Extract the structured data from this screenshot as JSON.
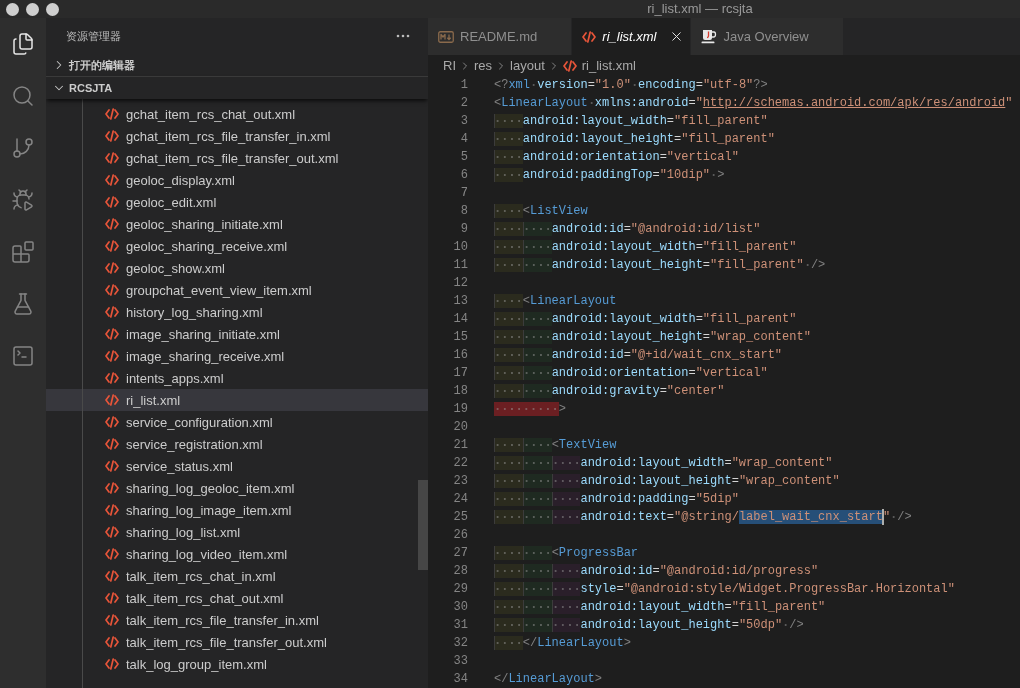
{
  "window": {
    "title": "ri_list.xml — rcsjta"
  },
  "activity_bar": [
    {
      "kind": "files",
      "selected": true
    },
    {
      "kind": "search",
      "selected": false
    },
    {
      "kind": "source_control",
      "selected": false
    },
    {
      "kind": "run_debug",
      "selected": false
    },
    {
      "kind": "extensions",
      "selected": false
    },
    {
      "kind": "testing",
      "selected": false
    },
    {
      "kind": "terminal",
      "selected": false
    }
  ],
  "sidebar": {
    "title": "资源管理器",
    "sections": [
      {
        "label": "打开的编辑器",
        "expanded": false
      },
      {
        "label": "RCSJTA",
        "expanded": true,
        "files": [
          {
            "name": "gchat_item_rcs_chat_out.xml",
            "selected": false
          },
          {
            "name": "gchat_item_rcs_file_transfer_in.xml",
            "selected": false
          },
          {
            "name": "gchat_item_rcs_file_transfer_out.xml",
            "selected": false
          },
          {
            "name": "geoloc_display.xml",
            "selected": false
          },
          {
            "name": "geoloc_edit.xml",
            "selected": false
          },
          {
            "name": "geoloc_sharing_initiate.xml",
            "selected": false
          },
          {
            "name": "geoloc_sharing_receive.xml",
            "selected": false
          },
          {
            "name": "geoloc_show.xml",
            "selected": false
          },
          {
            "name": "groupchat_event_view_item.xml",
            "selected": false
          },
          {
            "name": "history_log_sharing.xml",
            "selected": false
          },
          {
            "name": "image_sharing_initiate.xml",
            "selected": false
          },
          {
            "name": "image_sharing_receive.xml",
            "selected": false
          },
          {
            "name": "intents_apps.xml",
            "selected": false
          },
          {
            "name": "ri_list.xml",
            "selected": true
          },
          {
            "name": "service_configuration.xml",
            "selected": false
          },
          {
            "name": "service_registration.xml",
            "selected": false
          },
          {
            "name": "service_status.xml",
            "selected": false
          },
          {
            "name": "sharing_log_geoloc_item.xml",
            "selected": false
          },
          {
            "name": "sharing_log_image_item.xml",
            "selected": false
          },
          {
            "name": "sharing_log_list.xml",
            "selected": false
          },
          {
            "name": "sharing_log_video_item.xml",
            "selected": false
          },
          {
            "name": "talk_item_rcs_chat_in.xml",
            "selected": false
          },
          {
            "name": "talk_item_rcs_chat_out.xml",
            "selected": false
          },
          {
            "name": "talk_item_rcs_file_transfer_in.xml",
            "selected": false
          },
          {
            "name": "talk_item_rcs_file_transfer_out.xml",
            "selected": false
          },
          {
            "name": "talk_log_group_item.xml",
            "selected": false
          }
        ]
      }
    ]
  },
  "tabs": [
    {
      "label": "README.md",
      "kind": "markdown",
      "selected": false,
      "preview": false
    },
    {
      "label": "ri_list.xml",
      "kind": "xml",
      "selected": true,
      "preview": true
    },
    {
      "label": "Java Overview",
      "kind": "java",
      "selected": false,
      "preview": false
    }
  ],
  "breadcrumb": [
    {
      "label": "RI",
      "kind": "folder"
    },
    {
      "label": "res",
      "kind": "folder"
    },
    {
      "label": "layout",
      "kind": "folder"
    },
    {
      "label": "ri_list.xml",
      "kind": "xml"
    }
  ],
  "editor": {
    "lines": [
      {
        "number": "1",
        "tokens": [
          {
            "kind": "delim",
            "text": "<?"
          },
          {
            "kind": "tag",
            "text": "xml"
          },
          {
            "kind": "attr",
            "text": " version"
          },
          {
            "kind": "eq",
            "text": "="
          },
          {
            "kind": "value",
            "text": "\"1.0\""
          },
          {
            "kind": "attr",
            "text": " encoding"
          },
          {
            "kind": "eq",
            "text": "="
          },
          {
            "kind": "value",
            "text": "\"utf-8\""
          },
          {
            "kind": "delim",
            "text": "?>"
          }
        ]
      },
      {
        "number": "2",
        "tokens": [
          {
            "kind": "delim",
            "text": "<"
          },
          {
            "kind": "tag",
            "text": "LinearLayout"
          },
          {
            "kind": "attr",
            "text": " xmlns:android"
          },
          {
            "kind": "eq",
            "text": "="
          },
          {
            "kind": "value",
            "text": "\""
          },
          {
            "kind": "link",
            "text": "http://schemas.android.com/apk/res/android"
          },
          {
            "kind": "value",
            "text": "\""
          }
        ]
      },
      {
        "number": "3",
        "tokens": [
          {
            "kind": "attr",
            "text": "    android:layout_width"
          },
          {
            "kind": "eq",
            "text": "="
          },
          {
            "kind": "value",
            "text": "\"fill_parent\""
          }
        ]
      },
      {
        "number": "4",
        "tokens": [
          {
            "kind": "attr",
            "text": "    android:layout_height"
          },
          {
            "kind": "eq",
            "text": "="
          },
          {
            "kind": "value",
            "text": "\"fill_parent\""
          }
        ]
      },
      {
        "number": "5",
        "tokens": [
          {
            "kind": "attr",
            "text": "    android:orientation"
          },
          {
            "kind": "eq",
            "text": "="
          },
          {
            "kind": "value",
            "text": "\"vertical\""
          }
        ]
      },
      {
        "number": "6",
        "tokens": [
          {
            "kind": "attr",
            "text": "    android:paddingTop"
          },
          {
            "kind": "eq",
            "text": "="
          },
          {
            "kind": "value",
            "text": "\"10dip\""
          },
          {
            "kind": "delim",
            "text": " >"
          }
        ]
      },
      {
        "number": "7"
      },
      {
        "number": "8",
        "tokens": [
          {
            "kind": "delim",
            "text": "    <"
          },
          {
            "kind": "tag",
            "text": "ListView"
          }
        ]
      },
      {
        "number": "9",
        "tokens": [
          {
            "kind": "attr",
            "text": "        android:id"
          },
          {
            "kind": "eq",
            "text": "="
          },
          {
            "kind": "value",
            "text": "\"@android:id/list\""
          }
        ]
      },
      {
        "number": "10",
        "tokens": [
          {
            "kind": "attr",
            "text": "        android:layout_width"
          },
          {
            "kind": "eq",
            "text": "="
          },
          {
            "kind": "value",
            "text": "\"fill_parent\""
          }
        ]
      },
      {
        "number": "11",
        "tokens": [
          {
            "kind": "attr",
            "text": "        android:layout_height"
          },
          {
            "kind": "eq",
            "text": "="
          },
          {
            "kind": "value",
            "text": "\"fill_parent\""
          },
          {
            "kind": "delim",
            "text": " />"
          }
        ]
      },
      {
        "number": "12"
      },
      {
        "number": "13",
        "tokens": [
          {
            "kind": "delim",
            "text": "    <"
          },
          {
            "kind": "tag",
            "text": "LinearLayout"
          }
        ]
      },
      {
        "number": "14",
        "tokens": [
          {
            "kind": "attr",
            "text": "        android:layout_width"
          },
          {
            "kind": "eq",
            "text": "="
          },
          {
            "kind": "value",
            "text": "\"fill_parent\""
          }
        ]
      },
      {
        "number": "15",
        "tokens": [
          {
            "kind": "attr",
            "text": "        android:layout_height"
          },
          {
            "kind": "eq",
            "text": "="
          },
          {
            "kind": "value",
            "text": "\"wrap_content\""
          }
        ]
      },
      {
        "number": "16",
        "tokens": [
          {
            "kind": "attr",
            "text": "        android:id"
          },
          {
            "kind": "eq",
            "text": "="
          },
          {
            "kind": "value",
            "text": "\"@+id/wait_cnx_start\""
          }
        ]
      },
      {
        "number": "17",
        "tokens": [
          {
            "kind": "attr",
            "text": "        android:orientation"
          },
          {
            "kind": "eq",
            "text": "="
          },
          {
            "kind": "value",
            "text": "\"vertical\""
          }
        ]
      },
      {
        "number": "18",
        "tokens": [
          {
            "kind": "attr",
            "text": "        android:gravity"
          },
          {
            "kind": "eq",
            "text": "="
          },
          {
            "kind": "value",
            "text": "\"center\""
          }
        ]
      },
      {
        "number": "19",
        "tokens": [
          {
            "kind": "delim",
            "text": "         >"
          }
        ]
      },
      {
        "number": "20"
      },
      {
        "number": "21",
        "tokens": [
          {
            "kind": "delim",
            "text": "        <"
          },
          {
            "kind": "tag",
            "text": "TextView"
          }
        ]
      },
      {
        "number": "22",
        "tokens": [
          {
            "kind": "attr",
            "text": "            android:layout_width"
          },
          {
            "kind": "eq",
            "text": "="
          },
          {
            "kind": "value",
            "text": "\"wrap_content\""
          }
        ]
      },
      {
        "number": "23",
        "tokens": [
          {
            "kind": "attr",
            "text": "            android:layout_height"
          },
          {
            "kind": "eq",
            "text": "="
          },
          {
            "kind": "value",
            "text": "\"wrap_content\""
          }
        ]
      },
      {
        "number": "24",
        "tokens": [
          {
            "kind": "attr",
            "text": "            android:padding"
          },
          {
            "kind": "eq",
            "text": "="
          },
          {
            "kind": "value",
            "text": "\"5dip\""
          }
        ]
      },
      {
        "number": "25",
        "tokens": [
          {
            "kind": "attr",
            "text": "            android:text"
          },
          {
            "kind": "eq",
            "text": "="
          },
          {
            "kind": "value",
            "text": "\"@string/"
          },
          {
            "kind": "selection",
            "text": "label_wait_cnx_start",
            "cursor": true
          },
          {
            "kind": "value",
            "text": "\""
          },
          {
            "kind": "delim",
            "text": " />"
          }
        ]
      },
      {
        "number": "26"
      },
      {
        "number": "27",
        "tokens": [
          {
            "kind": "delim",
            "text": "        <"
          },
          {
            "kind": "tag",
            "text": "ProgressBar"
          }
        ]
      },
      {
        "number": "28",
        "tokens": [
          {
            "kind": "attr",
            "text": "            android:id"
          },
          {
            "kind": "eq",
            "text": "="
          },
          {
            "kind": "value",
            "text": "\"@android:id/progress\""
          }
        ]
      },
      {
        "number": "29",
        "tokens": [
          {
            "kind": "attr",
            "text": "            style"
          },
          {
            "kind": "eq",
            "text": "="
          },
          {
            "kind": "value",
            "text": "\"@android:style/Widget.ProgressBar.Horizontal\""
          }
        ]
      },
      {
        "number": "30",
        "tokens": [
          {
            "kind": "attr",
            "text": "            android:layout_width"
          },
          {
            "kind": "eq",
            "text": "="
          },
          {
            "kind": "value",
            "text": "\"fill_parent\""
          }
        ]
      },
      {
        "number": "31",
        "tokens": [
          {
            "kind": "attr",
            "text": "            android:layout_height"
          },
          {
            "kind": "eq",
            "text": "="
          },
          {
            "kind": "value",
            "text": "\"50dp\""
          },
          {
            "kind": "delim",
            "text": " />"
          }
        ]
      },
      {
        "number": "32",
        "tokens": [
          {
            "kind": "delim",
            "text": "    </"
          },
          {
            "kind": "tag",
            "text": "LinearLayout"
          },
          {
            "kind": "delim",
            "text": ">"
          }
        ]
      },
      {
        "number": "33"
      },
      {
        "number": "34",
        "tokens": [
          {
            "kind": "delim",
            "text": "</"
          },
          {
            "kind": "tag",
            "text": "LinearLayout"
          },
          {
            "kind": "delim",
            "text": ">"
          }
        ]
      }
    ]
  }
}
